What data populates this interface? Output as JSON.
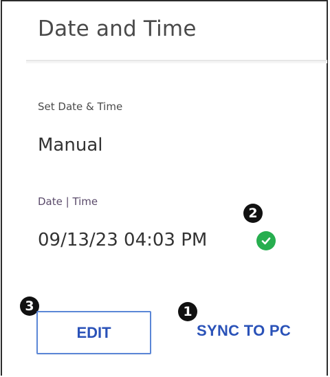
{
  "panel": {
    "title": "Date and Time"
  },
  "set_date_time": {
    "label": "Set Date & Time",
    "value": "Manual"
  },
  "date_time": {
    "label": "Date | Time",
    "value": "09/13/23 04:03 PM",
    "status_icon": "check-circle-icon",
    "status_color": "#27ae4f"
  },
  "callouts": {
    "one": "1",
    "two": "2",
    "three": "3"
  },
  "actions": {
    "edit_label": "EDIT",
    "sync_label": "SYNC TO PC",
    "accent_color": "#2a52b8"
  }
}
